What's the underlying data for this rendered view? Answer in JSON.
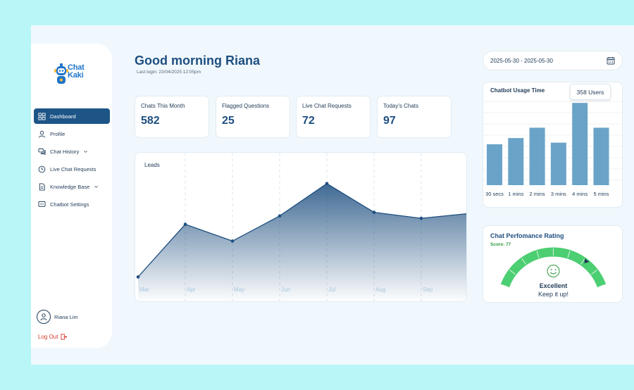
{
  "brand": {
    "line1": "Chat",
    "line2": "Kaki",
    "color": "#1f74c9"
  },
  "sidebar": {
    "items": [
      {
        "label": "Dashboard",
        "icon": "grid-icon"
      },
      {
        "label": "Profile",
        "icon": "user-icon"
      },
      {
        "label": "Chat History",
        "icon": "chat-bubbles-icon"
      },
      {
        "label": "Live Chat Requests",
        "icon": "clock-icon"
      },
      {
        "label": "Knowledge Base",
        "icon": "document-icon"
      },
      {
        "label": "Chatbot Settings",
        "icon": "chat-dots-icon"
      }
    ],
    "user_name": "Riana Lim",
    "logout_label": "Log Out"
  },
  "header": {
    "greeting": "Good morning Riana",
    "last_login": "Last login: 23/04/2025 12:05pm"
  },
  "stats": [
    {
      "label": "Chats This Month",
      "value": "582"
    },
    {
      "label": "Flagged Questions",
      "value": "25"
    },
    {
      "label": "Live Chat Requests",
      "value": "72"
    },
    {
      "label": "Today's Chats",
      "value": "97"
    }
  ],
  "date_range": "2025-05-30 - 2025-05-30",
  "colors": {
    "primary": "#1e5587",
    "bar": "#6aa3c8",
    "gauge": "#4cce72",
    "logout": "#d7392f"
  },
  "leads": {
    "title": "Leads",
    "chart_data": {
      "type": "area",
      "categories": [
        "Mar",
        "Apr",
        "May",
        "Jun",
        "Jul",
        "Aug",
        "Sep"
      ],
      "values": [
        8,
        52,
        38,
        59,
        86,
        62,
        57,
        61
      ],
      "ylim": [
        0,
        100
      ],
      "grid": "vertical-dashed"
    }
  },
  "usage": {
    "title": "Chatbot Usage Time",
    "tooltip": "358 Users",
    "chart_data": {
      "type": "bar",
      "categories": [
        "30 secs",
        "1 mins",
        "2 mins",
        "3 mins",
        "4 mins",
        "5 mins"
      ],
      "values": [
        178,
        205,
        250,
        185,
        358,
        250
      ],
      "ylim": [
        0,
        380
      ]
    }
  },
  "performance": {
    "title": "Chat Perfomance Rating",
    "score_label": "Score: 77",
    "score": 77,
    "status": "Excellent",
    "message": "Keep it up!"
  }
}
